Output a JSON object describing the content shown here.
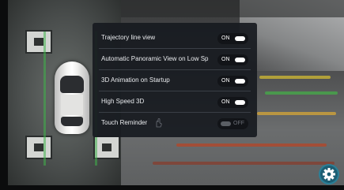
{
  "settings": {
    "items": [
      {
        "label": "Trajectory  line view",
        "state": "ON"
      },
      {
        "label": "Automatic Panoramic View on Low Sp",
        "state": "ON"
      },
      {
        "label": "3D Animation on Startup",
        "state": "ON"
      },
      {
        "label": "High Speed 3D",
        "state": "ON"
      },
      {
        "label": "Touch  Reminder",
        "state": "OFF"
      }
    ]
  },
  "icons": {
    "settings": "gear-icon",
    "touch": "hand-icon"
  },
  "colors": {
    "dialog": "#181b20",
    "lane": "#3fb34a",
    "accent": "#1d5e73"
  }
}
